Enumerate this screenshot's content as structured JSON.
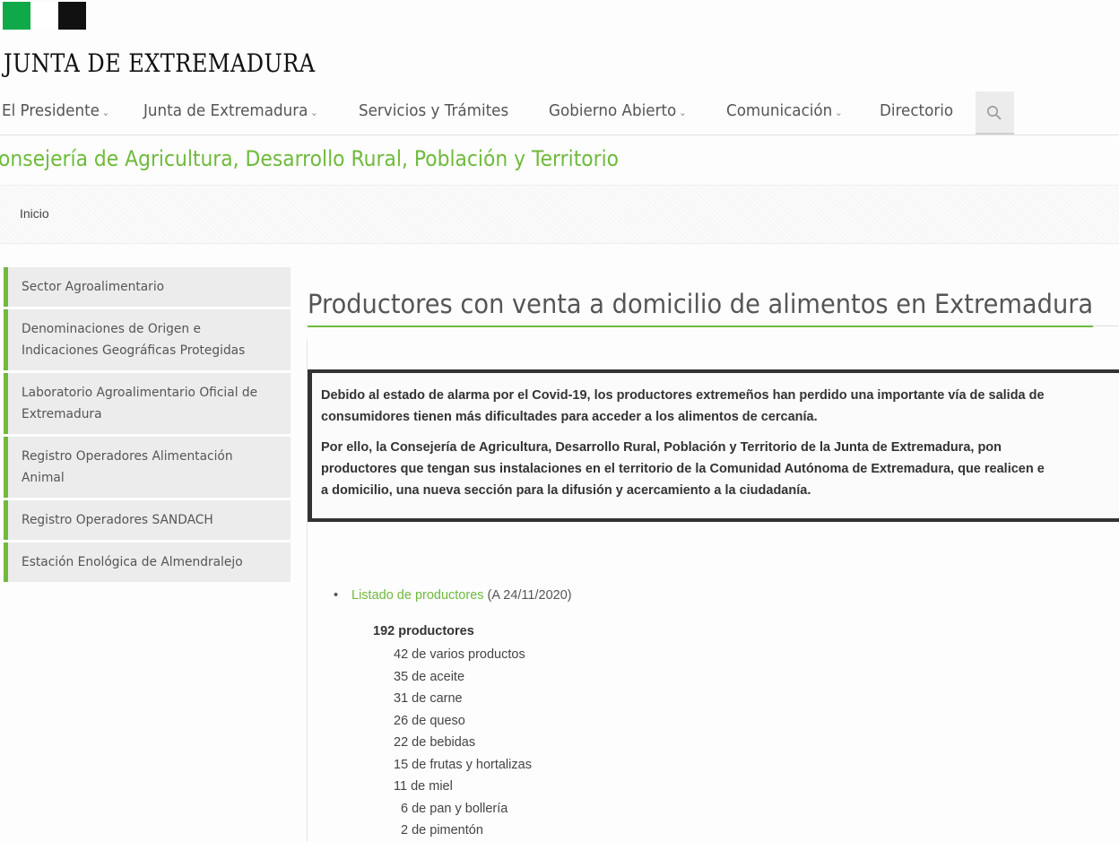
{
  "brand": {
    "name": "JUNTA DE EXTREMADURA"
  },
  "nav": {
    "items": [
      {
        "label": "El Presidente",
        "dropdown": true
      },
      {
        "label": "Junta de Extremadura",
        "dropdown": true
      },
      {
        "label": "Servicios y Trámites",
        "dropdown": false
      },
      {
        "label": "Gobierno Abierto",
        "dropdown": true
      },
      {
        "label": "Comunicación",
        "dropdown": true
      },
      {
        "label": "Directorio",
        "dropdown": false
      }
    ],
    "search_icon": "search-icon"
  },
  "department": "onsejería de Agricultura, Desarrollo Rural, Población y Territorio",
  "breadcrumb": {
    "home": "Inicio"
  },
  "sidebar": {
    "items": [
      {
        "label": "Sector Agroalimentario"
      },
      {
        "label": "Denominaciones de Origen e Indicaciones Geográficas Protegidas"
      },
      {
        "label": "Laboratorio Agroalimentario Oficial de Extremadura"
      },
      {
        "label": "Registro Operadores Alimentación Animal"
      },
      {
        "label": "Registro Operadores SANDACH"
      },
      {
        "label": "Estación Enológica de Almendralejo"
      }
    ]
  },
  "page": {
    "title": "Productores con venta a domicilio de alimentos en Extremadura"
  },
  "notice": {
    "p1_l1": "Debido al estado de alarma por el Covid-19, los productores extremeños han perdido una importante vía de salida de",
    "p1_l2": "consumidores tienen más dificultades para acceder a los alimentos de cercanía.",
    "p2_l1": "Por ello, la Consejería de Agricultura, Desarrollo Rural, Población y Territorio de la Junta de Extremadura, pon",
    "p2_l2": "productores que tengan sus instalaciones en el territorio de la Comunidad Autónoma de Extremadura, que realicen e",
    "p2_l3": "a domicilio, una nueva sección para la difusión y acercamiento a la ciudadanía."
  },
  "listing": {
    "bullet": "•",
    "link_text": "Listado de productores",
    "date_note": " (A 24/11/2020)",
    "total": "192 productores",
    "rows": [
      "42 de varios productos",
      "35 de aceite",
      "31 de carne",
      "26 de queso",
      "22 de bebidas",
      "15 de frutas y hortalizas",
      "11 de miel",
      "6 de pan y bollería",
      "2 de pimentón"
    ]
  },
  "colors": {
    "accent": "#6fba3c",
    "flag_green": "#0fa949",
    "flag_white": "#ffffff",
    "flag_black": "#111111"
  }
}
